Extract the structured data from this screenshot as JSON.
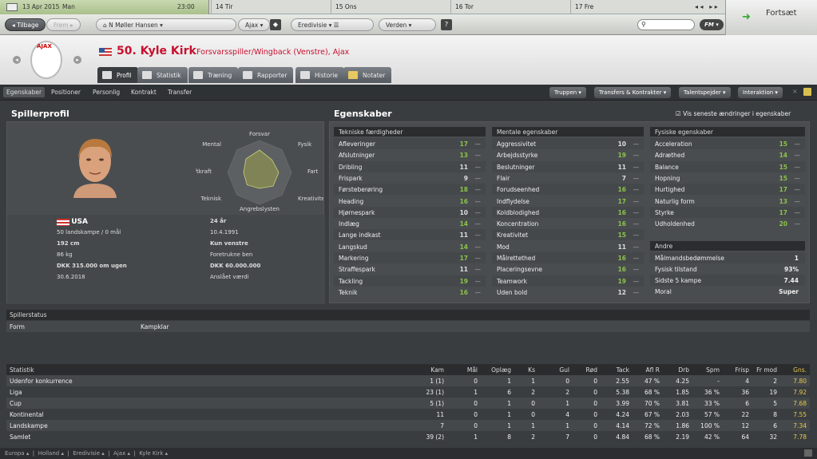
{
  "topbar": {
    "date": "13 Apr 2015",
    "day": "Man",
    "time": "23:00",
    "days": [
      "14 Tir",
      "15 Ons",
      "16 Tor",
      "17 Fre"
    ]
  },
  "nav": {
    "back": "Tilbage",
    "forward": "Frem",
    "manager": "N Møller Hansen",
    "club": "Ajax",
    "league": "Eredivisie",
    "world": "Verden",
    "continue": "Fortsæt",
    "fm": "FM"
  },
  "header": {
    "logo_text": "AJAX",
    "player_title": "50. Kyle Kirk",
    "player_sub": "Forsvarsspiller/Wingback (Venstre), Ajax"
  },
  "tabs": [
    "Profil",
    "Statistik",
    "Træning",
    "Rapporter",
    "Historie",
    "Notater"
  ],
  "subtabs": [
    "Egenskaber",
    "Positioner",
    "Personlig",
    "Kontrakt",
    "Transfer"
  ],
  "action_buttons": [
    "Truppen",
    "Transfers & Kontrakter",
    "Talentspejder",
    "Interaktion"
  ],
  "profile": {
    "heading": "Spillerprofil",
    "radar_labels": {
      "top": "Forsvar",
      "tl": "Mental",
      "tr": "Fysik",
      "l": "Luftkraft",
      "r": "Fart",
      "bl": "Teknisk",
      "br": "Kreativitet",
      "b": "Angrebslysten"
    },
    "radar_values": [
      0.7,
      0.55,
      0.6,
      0.6,
      0.5,
      0.55,
      0.5,
      0.6
    ],
    "nation": "USA",
    "caps": "50 landskampe / 0 mål",
    "age": "24 år",
    "dob": "10.4.1991",
    "height": "192 cm",
    "weight": "86 kg",
    "foot": "Kun venstre",
    "foot_label": "Foretrukne ben",
    "wage": "DKK 315.000 om ugen",
    "contract": "30.6.2018",
    "value": "DKK 60.000.000",
    "value_label": "Anslået værdi"
  },
  "attributes": {
    "heading": "Egenskaber",
    "show_changes": "Vis seneste ændringer i egenskaber",
    "technical_title": "Tekniske færdigheder",
    "technical": [
      [
        "Afleveringer",
        17
      ],
      [
        "Afslutninger",
        13
      ],
      [
        "Dribling",
        11
      ],
      [
        "Frispark",
        9
      ],
      [
        "Førsteberøring",
        18
      ],
      [
        "Heading",
        16
      ],
      [
        "Hjørnespark",
        10
      ],
      [
        "Indlæg",
        14
      ],
      [
        "Lange indkast",
        11
      ],
      [
        "Langskud",
        14
      ],
      [
        "Markering",
        17
      ],
      [
        "Straffespark",
        11
      ],
      [
        "Tackling",
        19
      ],
      [
        "Teknik",
        16
      ]
    ],
    "mental_title": "Mentale egenskaber",
    "mental": [
      [
        "Aggressivitet",
        10
      ],
      [
        "Arbejdsstyrke",
        19
      ],
      [
        "Beslutninger",
        11
      ],
      [
        "Flair",
        7
      ],
      [
        "Forudseenhed",
        16
      ],
      [
        "Indflydelse",
        17
      ],
      [
        "Koldblodighed",
        16
      ],
      [
        "Koncentration",
        16
      ],
      [
        "Kreativitet",
        15
      ],
      [
        "Mod",
        11
      ],
      [
        "Målrettethed",
        16
      ],
      [
        "Placeringsevne",
        16
      ],
      [
        "Teamwork",
        19
      ],
      [
        "Uden bold",
        12
      ]
    ],
    "physical_title": "Fysiske egenskaber",
    "physical": [
      [
        "Acceleration",
        15
      ],
      [
        "Adræthed",
        14
      ],
      [
        "Balance",
        15
      ],
      [
        "Hopning",
        15
      ],
      [
        "Hurtighed",
        17
      ],
      [
        "Naturlig form",
        13
      ],
      [
        "Styrke",
        17
      ],
      [
        "Udholdenhed",
        20
      ]
    ],
    "other_title": "Andre",
    "other": [
      [
        "Målmandsbedømmelse",
        "1"
      ],
      [
        "Fysisk tilstand",
        "93%"
      ],
      [
        "Sidste 5 kampe",
        "7.44"
      ],
      [
        "Moral",
        "Super"
      ]
    ]
  },
  "status": {
    "title": "Spillerstatus",
    "label": "Form",
    "value": "Kampklar"
  },
  "stats": {
    "columns": [
      "Statistik",
      "Kam",
      "Mål",
      "Oplæg",
      "Ks",
      "Gul",
      "Rød",
      "Tack",
      "Afl R",
      "Drb",
      "Spm",
      "Frisp",
      "Fr mod",
      "Gns."
    ],
    "rows": [
      [
        "Udenfor konkurrence",
        "1 (1)",
        "0",
        "1",
        "1",
        "0",
        "0",
        "2.55",
        "47 %",
        "4.25",
        "-",
        "4",
        "2",
        "7.80"
      ],
      [
        "Liga",
        "23 (1)",
        "1",
        "6",
        "2",
        "2",
        "0",
        "5.38",
        "68 %",
        "1.85",
        "36 %",
        "36",
        "19",
        "7.92"
      ],
      [
        "Cup",
        "5 (1)",
        "0",
        "1",
        "0",
        "1",
        "0",
        "3.99",
        "70 %",
        "3.81",
        "33 %",
        "6",
        "5",
        "7.68"
      ],
      [
        "Kontinental",
        "11",
        "0",
        "1",
        "0",
        "4",
        "0",
        "4.24",
        "67 %",
        "2.03",
        "57 %",
        "22",
        "8",
        "7.55"
      ],
      [
        "Landskampe",
        "7",
        "0",
        "1",
        "1",
        "1",
        "0",
        "4.14",
        "72 %",
        "1.86",
        "100 %",
        "12",
        "6",
        "7.34"
      ],
      [
        "Samlet",
        "39 (2)",
        "1",
        "8",
        "2",
        "7",
        "0",
        "4.84",
        "68 %",
        "2.19",
        "42 %",
        "64",
        "32",
        "7.78"
      ]
    ]
  },
  "breadcrumb": [
    "Europa",
    "Holland",
    "Eredivisie",
    "Ajax",
    "Kyle Kirk"
  ]
}
